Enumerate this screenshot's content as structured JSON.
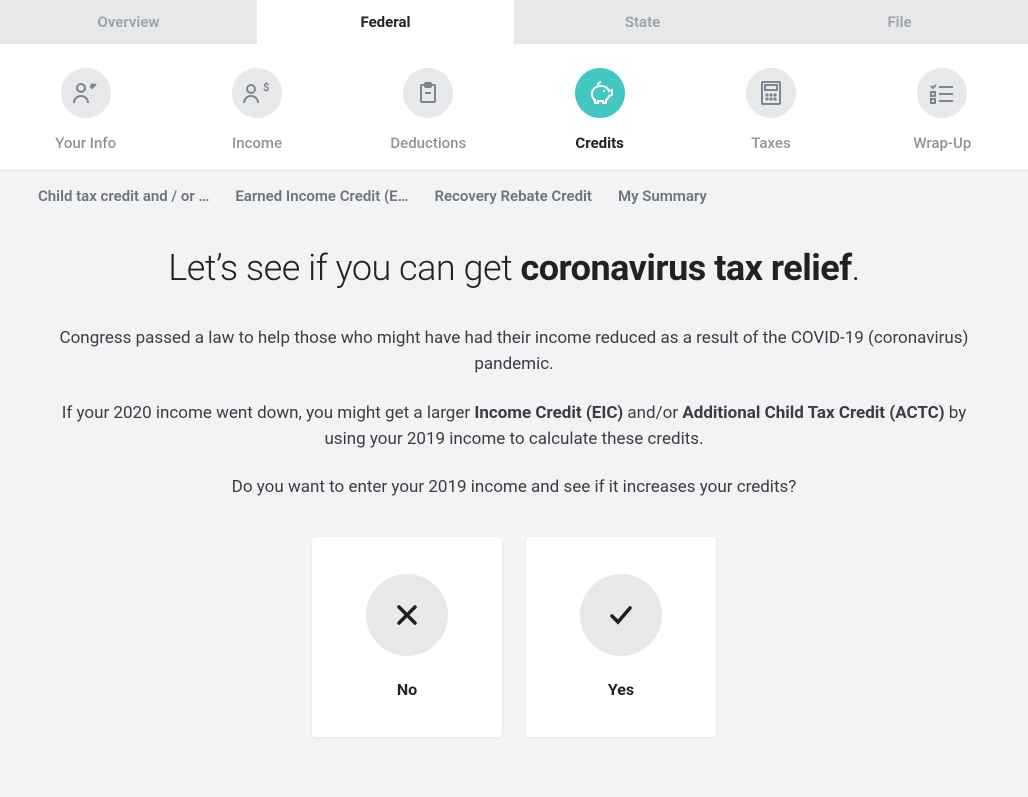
{
  "top_tabs": [
    {
      "label": "Overview",
      "active": false
    },
    {
      "label": "Federal",
      "active": true
    },
    {
      "label": "State",
      "active": false
    },
    {
      "label": "File",
      "active": false
    }
  ],
  "steps": [
    {
      "label": "Your Info",
      "icon": "person",
      "active": false
    },
    {
      "label": "Income",
      "icon": "money",
      "active": false
    },
    {
      "label": "Deductions",
      "icon": "clipboard",
      "active": false
    },
    {
      "label": "Credits",
      "icon": "piggy",
      "active": true
    },
    {
      "label": "Taxes",
      "icon": "calc",
      "active": false
    },
    {
      "label": "Wrap-Up",
      "icon": "checklist",
      "active": false
    }
  ],
  "breadcrumbs": [
    "Child tax credit and / or …",
    "Earned Income Credit (E…",
    "Recovery Rebate Credit",
    "My Summary"
  ],
  "content": {
    "title_prefix": "Let’s see if you can get ",
    "title_bold": "coronavirus tax relief",
    "title_suffix": ".",
    "p1": "Congress passed a law to help those who might have had their income reduced as a result of the COVID-19 (coronavirus) pandemic.",
    "p2_a": "If your 2020 income went down, you might get a larger ",
    "p2_b1": "Income Credit (EIC)",
    "p2_mid": " and/or ",
    "p2_b2": "Additional Child Tax Credit (ACTC)",
    "p2_c": " by using your 2019 income to calculate these credits.",
    "p3": "Do you want to enter your 2019 income and see if it increases your credits?",
    "choice_no": "No",
    "choice_yes": "Yes"
  }
}
